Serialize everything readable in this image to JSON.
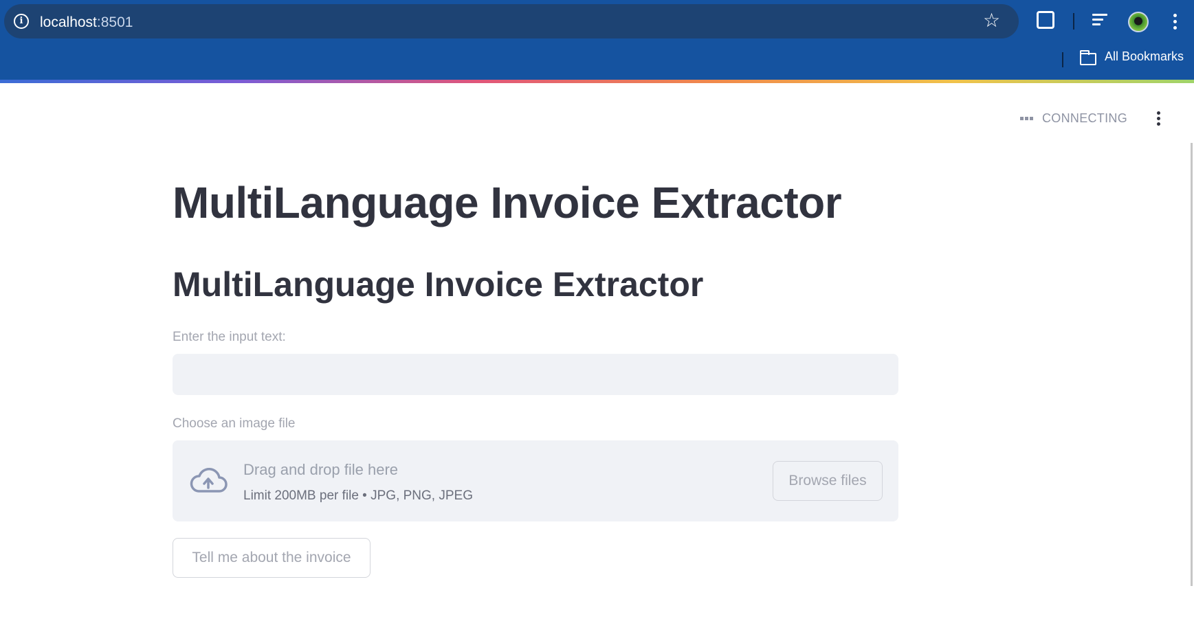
{
  "browser": {
    "url_host": "localhost",
    "url_port": ":8501",
    "bookmarks_label": "All Bookmarks",
    "icons": [
      "info-icon",
      "star-icon",
      "extensions-icon",
      "media-queue-icon",
      "profile-avatar",
      "menu-icon",
      "folder-icon"
    ]
  },
  "app_header": {
    "status_text": "CONNECTING"
  },
  "main": {
    "title": "MultiLanguage Invoice Extractor",
    "subheader": "MultiLanguage Invoice Extractor",
    "text_input": {
      "label": "Enter the input text:",
      "value": "",
      "placeholder": ""
    },
    "file_uploader": {
      "label": "Choose an image file",
      "drop_text": "Drag and drop file here",
      "limit_text": "Limit 200MB per file • JPG, PNG, JPEG",
      "browse_label": "Browse files"
    },
    "submit_label": "Tell me about the invoice"
  },
  "colors": {
    "browser_bar": "#1553a0",
    "omnibox": "#1d4373",
    "text_primary": "#31333f",
    "text_muted": "#a3a6b0",
    "input_bg": "#f0f2f6"
  }
}
